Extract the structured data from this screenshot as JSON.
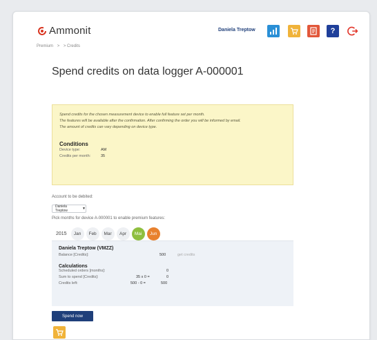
{
  "header": {
    "logo_text": "Ammonit",
    "user_name": "Daniela Treptow",
    "help_glyph": "?",
    "icons": [
      "chart-icon",
      "cart-icon",
      "document-icon",
      "help-icon",
      "logout-icon"
    ]
  },
  "breadcrumb": [
    "Premium",
    ">",
    "> Credits"
  ],
  "page": {
    "title": "Spend credits on data logger A-000001"
  },
  "info_box": {
    "lines": [
      "Spend credits for the chosen measurement device to enable full feature set per month.",
      "The features will be available after the confirmation. After confirming the order you will be informed by email.",
      "The amount of credits can vary depending on device type."
    ],
    "conditions_title": "Conditions",
    "device_type_label": "Device type:",
    "device_type_value": "AM",
    "credits_per_month_label": "Credits per month:",
    "credits_per_month_value": "35"
  },
  "account": {
    "label": "Account to be debited:",
    "selected": "Daniela Treptow"
  },
  "months": {
    "instruction": "Pick months for device A-000001 to enable premium features:",
    "year": "2015",
    "items": [
      {
        "label": "Jan",
        "state": "default"
      },
      {
        "label": "Feb",
        "state": "default"
      },
      {
        "label": "Mar",
        "state": "default"
      },
      {
        "label": "Apr",
        "state": "default"
      },
      {
        "label": "Mai",
        "state": "selected"
      },
      {
        "label": "Jun",
        "state": "current"
      }
    ]
  },
  "summary": {
    "account_title": "Daniela Treptow (VMZZ)",
    "balance_label": "Balance [Credits]:",
    "balance_value": "500",
    "get_credits": "get credits",
    "calc_title": "Calculations",
    "scheduled_label": "Scheduled orders [months]:",
    "scheduled_value": "0",
    "spend_label": "Sum to spend [Credits]:",
    "spend_expr": "35  x  0  =",
    "spend_value": "0",
    "left_label": "Credits left:",
    "left_expr": "500  -  0  =",
    "left_value": "500"
  },
  "actions": {
    "spend_now": "Spend now"
  },
  "colors": {
    "brand_red": "#d9341f",
    "navy": "#1f3f7a",
    "info_bg": "#fbf6c8",
    "selected_month": "#8fbf3f",
    "current_month": "#e8812e"
  }
}
